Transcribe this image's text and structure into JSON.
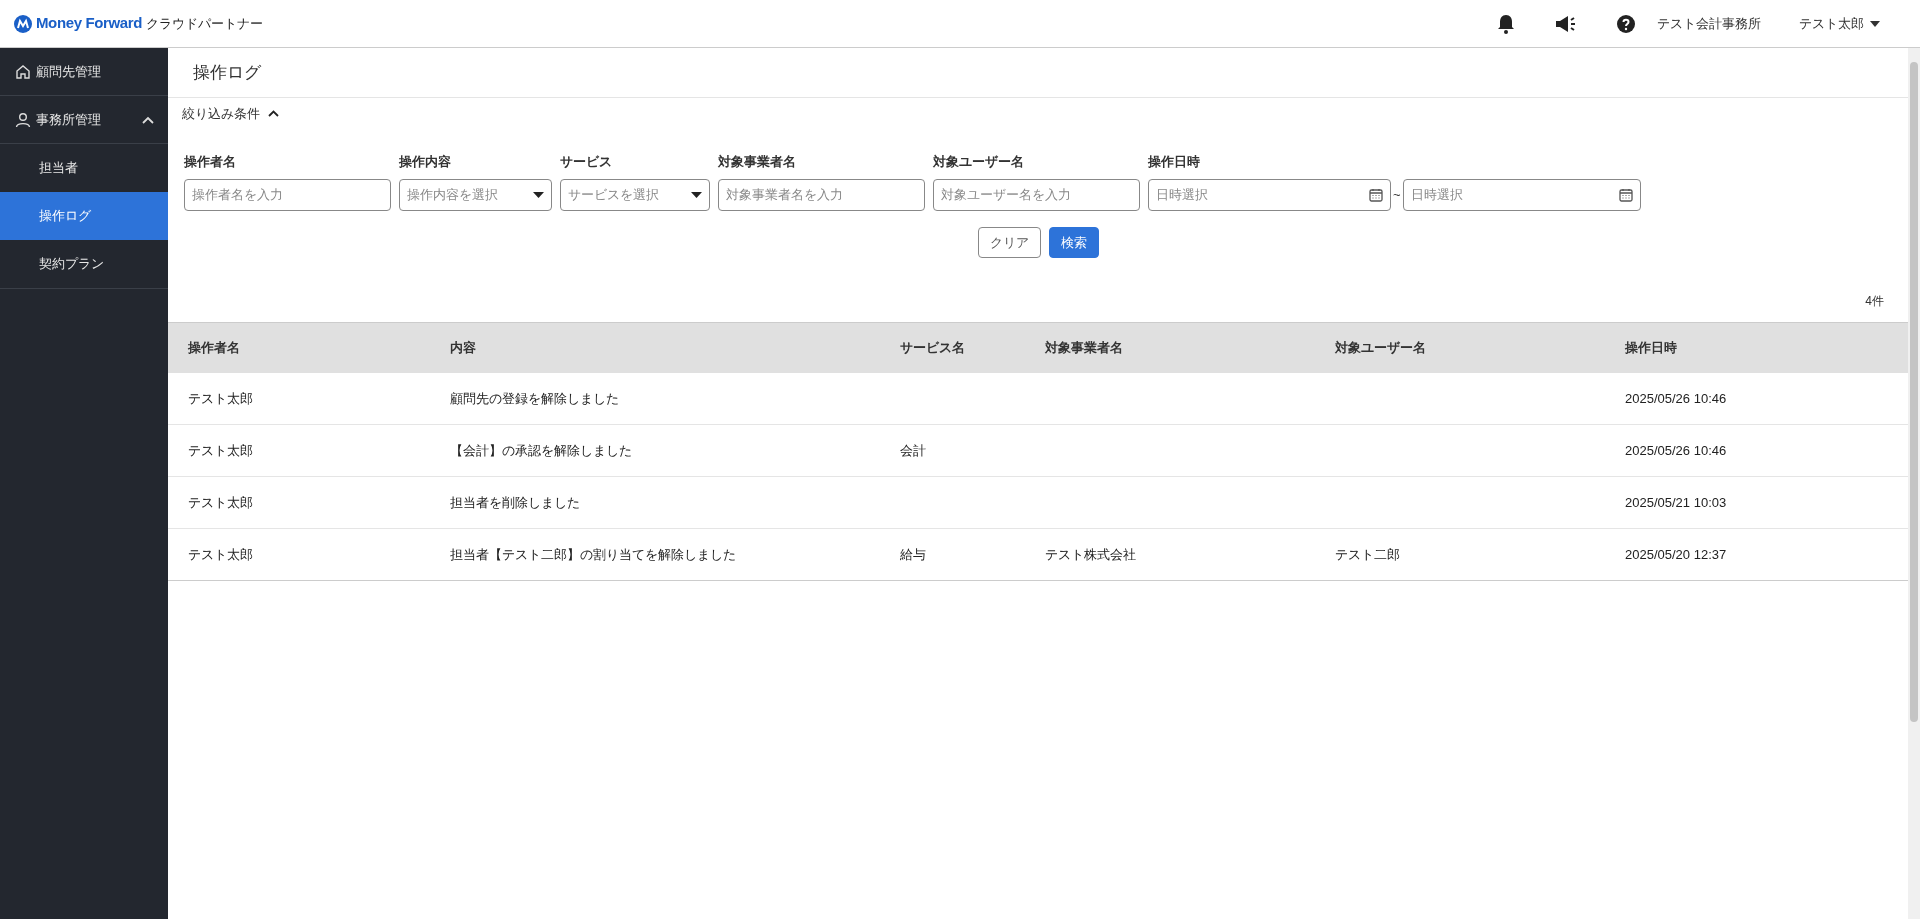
{
  "header": {
    "logo_text": "Money Forward",
    "product": "クラウドパートナー",
    "office": "テスト会計事務所",
    "user": "テスト太郎"
  },
  "sidebar": {
    "items": [
      {
        "label": "顧問先管理",
        "kind": "home",
        "selected": false
      },
      {
        "label": "事務所管理",
        "kind": "person",
        "expanded": true,
        "selected": false,
        "children": [
          {
            "label": "担当者",
            "selected": false
          },
          {
            "label": "操作ログ",
            "selected": true
          },
          {
            "label": "契約プラン",
            "selected": false
          }
        ]
      }
    ]
  },
  "page_title": "操作ログ",
  "filter": {
    "toggle_label": "絞り込み条件",
    "expanded": true,
    "fields": [
      {
        "label": "操作者名",
        "placeholder": "操作者名を入力",
        "kind": "text"
      },
      {
        "label": "操作内容",
        "placeholder": "操作内容を選択",
        "kind": "select"
      },
      {
        "label": "サービス",
        "placeholder": "サービスを選択",
        "kind": "select"
      },
      {
        "label": "対象事業者名",
        "placeholder": "対象事業者名を入力",
        "kind": "text"
      },
      {
        "label": "対象ユーザー名",
        "placeholder": "対象ユーザー名を入力",
        "kind": "text"
      },
      {
        "label": "操作日時",
        "placeholder": "日時選択",
        "kind": "date",
        "range_separator": "~",
        "placeholder_end": "日時選択"
      }
    ],
    "buttons": [
      {
        "label": "クリア",
        "kind": "secondary"
      },
      {
        "label": "検索",
        "kind": "primary"
      }
    ]
  },
  "result_count": "4件",
  "table": {
    "columns": [
      "操作者名",
      "内容",
      "サービス名",
      "対象事業者名",
      "対象ユーザー名",
      "操作日時"
    ],
    "rows": [
      [
        "テスト太郎",
        "顧問先の登録を解除しました",
        "",
        "",
        "",
        "2025/05/26 10:46"
      ],
      [
        "テスト太郎",
        "【会計】の承認を解除しました",
        "会計",
        "",
        "",
        "2025/05/26 10:46"
      ],
      [
        "テスト太郎",
        "担当者を削除しました",
        "",
        "",
        "",
        "2025/05/21 10:03"
      ],
      [
        "テスト太郎",
        "担当者【テスト二郎】の割り当てを解除しました",
        "給与",
        "テスト株式会社",
        "テスト二郎",
        "2025/05/20 12:37"
      ]
    ]
  }
}
